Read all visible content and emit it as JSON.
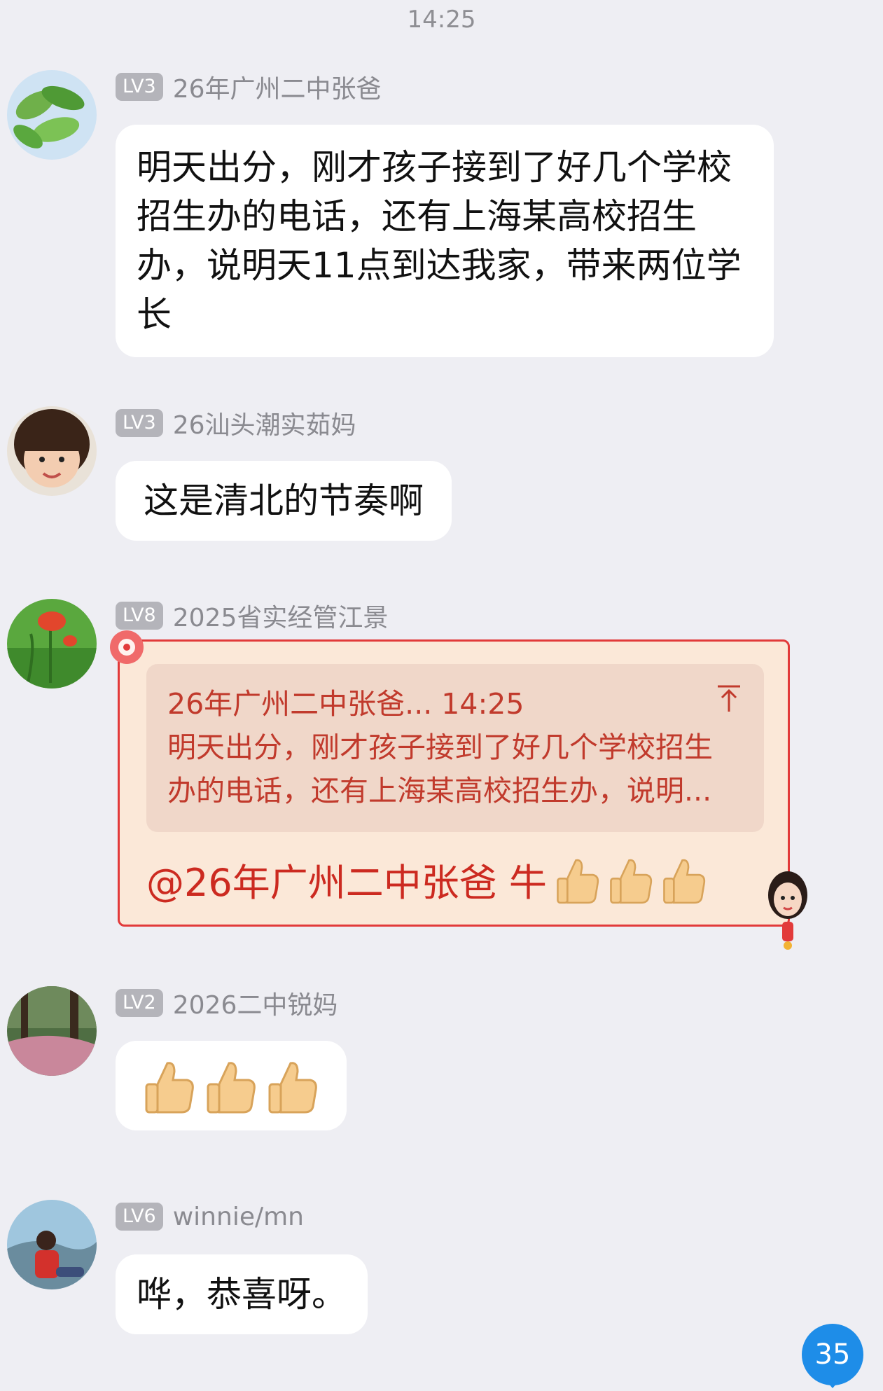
{
  "timestamp": "14:25",
  "messages": [
    {
      "level": "LV3",
      "sender": "26年广州二中张爸",
      "text": "明天出分，刚才孩子接到了好几个学校招生办的电话，还有上海某高校招生办，说明天11点到达我家，带来两位学长"
    },
    {
      "level": "LV3",
      "sender": "26汕头潮实茹妈",
      "text": "这是清北的节奏啊"
    },
    {
      "level": "LV8",
      "sender": "2025省实经管江景",
      "quote_header": "26年广州二中张爸... 14:25",
      "quote_line1": "明天出分，刚才孩子接到了好几个学校招生",
      "quote_line2": "办的电话，还有上海某高校招生办，说明...",
      "reply": "@26年广州二中张爸 牛"
    },
    {
      "level": "LV2",
      "sender": "2026二中锐妈",
      "emoji": "thumbs-up x3"
    },
    {
      "level": "LV6",
      "sender": "winnie/mn",
      "text": "哗，恭喜呀。"
    }
  ],
  "unread_badge": "35",
  "colors": {
    "background": "#eeeef3",
    "bubble": "#ffffff",
    "card_border": "#e23a3a",
    "card_text": "#cc2a20",
    "badge": "#1e8de8"
  }
}
